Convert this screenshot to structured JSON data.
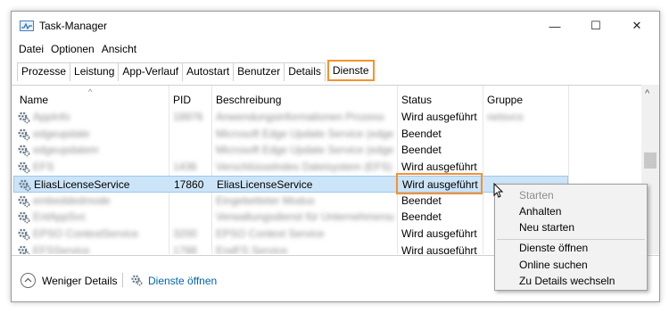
{
  "window": {
    "title": "Task-Manager",
    "controls": {
      "minimize": "—",
      "maximize": "☐",
      "close": "✕"
    }
  },
  "menu": [
    "Datei",
    "Optionen",
    "Ansicht"
  ],
  "tabs": [
    {
      "label": "Prozesse",
      "active": false
    },
    {
      "label": "Leistung",
      "active": false
    },
    {
      "label": "App-Verlauf",
      "active": false
    },
    {
      "label": "Autostart",
      "active": false
    },
    {
      "label": "Benutzer",
      "active": false
    },
    {
      "label": "Details",
      "active": false
    },
    {
      "label": "Dienste",
      "active": true
    }
  ],
  "table": {
    "columns": [
      "Name",
      "PID",
      "Beschreibung",
      "Status",
      "Gruppe"
    ],
    "rows": [
      {
        "name": "AppInfo",
        "pid": "18976",
        "desc": "Anwendungsinformationen Prozess",
        "status": "Wird ausgeführt",
        "group": "netsvcs",
        "selected": false
      },
      {
        "name": "edgeupdate",
        "pid": "",
        "desc": "Microsoft Edge Update Service (edgeupdate)",
        "status": "Beendet",
        "group": "",
        "selected": false
      },
      {
        "name": "edgeupdatem",
        "pid": "",
        "desc": "Microsoft Edge Update Service (edgeupdatem)",
        "status": "Beendet",
        "group": "",
        "selected": false
      },
      {
        "name": "EFS",
        "pid": "1436",
        "desc": "Verschlüsselndes Dateisystem (EFS)",
        "status": "Wird ausgeführt",
        "group": "",
        "selected": false
      },
      {
        "name": "EliasLicenseService",
        "pid": "17860",
        "desc": "EliasLicenseService",
        "status": "Wird ausgeführt",
        "group": "",
        "selected": true
      },
      {
        "name": "embeddedmode",
        "pid": "",
        "desc": "Eingebetteter Modus",
        "status": "Beendet",
        "group": "",
        "selected": false
      },
      {
        "name": "EntAppSvc",
        "pid": "",
        "desc": "Verwaltungsdienst für Unternehmensanwendungen",
        "status": "Beendet",
        "group": "",
        "selected": false
      },
      {
        "name": "EPSO ContextService",
        "pid": "3200",
        "desc": "EPSO Context Service",
        "status": "Wird ausgeführt",
        "group": "",
        "selected": false
      },
      {
        "name": "EFSService",
        "pid": "1788",
        "desc": "EndFS Service",
        "status": "Wird ausgeführt",
        "group": "",
        "selected": false
      }
    ]
  },
  "context_menu": {
    "items": [
      {
        "label": "Starten",
        "disabled": true
      },
      {
        "label": "Anhalten",
        "disabled": false
      },
      {
        "label": "Neu starten",
        "disabled": false
      },
      {
        "label": "Dienste öffnen",
        "disabled": false
      },
      {
        "label": "Online suchen",
        "disabled": false
      },
      {
        "label": "Zu Details wechseln",
        "disabled": false
      }
    ]
  },
  "footer": {
    "fewer_details": "Weniger Details",
    "open_services": "Dienste öffnen"
  },
  "colors": {
    "highlight": "#f5922f",
    "selection": "#cce4f7",
    "link": "#0063b1"
  }
}
